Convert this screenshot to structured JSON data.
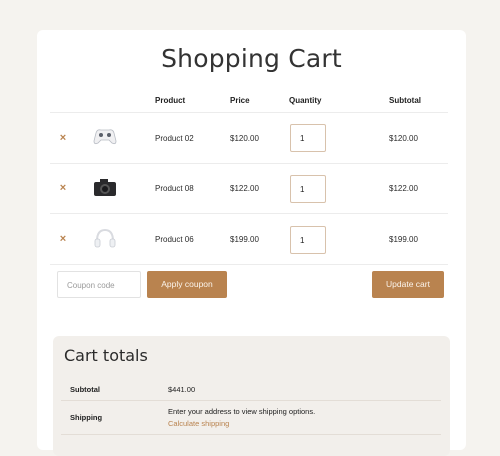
{
  "page": {
    "title": "Shopping Cart"
  },
  "table": {
    "headers": {
      "product": "Product",
      "price": "Price",
      "quantity": "Quantity",
      "subtotal": "Subtotal"
    },
    "remove_symbol": "×",
    "rows": [
      {
        "product": "Product 02",
        "price": "$120.00",
        "quantity": "1",
        "subtotal": "$120.00",
        "thumbnail": "game-controller-icon"
      },
      {
        "product": "Product 08",
        "price": "$122.00",
        "quantity": "1",
        "subtotal": "$122.00",
        "thumbnail": "camera-icon"
      },
      {
        "product": "Product 06",
        "price": "$199.00",
        "quantity": "1",
        "subtotal": "$199.00",
        "thumbnail": "headphones-icon"
      }
    ]
  },
  "coupon": {
    "placeholder": "Coupon code",
    "apply_label": "Apply coupon"
  },
  "update_label": "Update cart",
  "totals": {
    "title": "Cart totals",
    "subtotal_label": "Subtotal",
    "subtotal_value": "$441.00",
    "shipping_label": "Shipping",
    "shipping_text": "Enter your address to view shipping options.",
    "shipping_link": "Calculate shipping"
  },
  "colors": {
    "accent": "#b9834f",
    "page_bg": "#f5f3ef",
    "totals_bg": "#f2efeb"
  }
}
